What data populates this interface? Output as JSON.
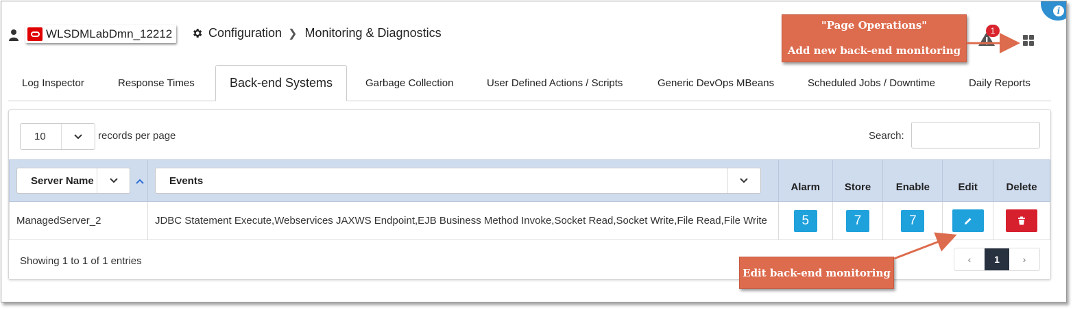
{
  "header": {
    "domain_name": "WLSDMLabDmn_12212",
    "breadcrumb": [
      "Configuration",
      "Monitoring & Diagnostics"
    ],
    "alert_count": "1"
  },
  "callouts": {
    "page_ops_title": "\"Page Operations\"",
    "page_ops_text": "Add new back-end monitoring",
    "edit_text": "Edit back-end monitoring"
  },
  "tabs": [
    {
      "label": "Log Inspector"
    },
    {
      "label": "Response Times"
    },
    {
      "label": "Back-end Systems",
      "active": true
    },
    {
      "label": "Garbage Collection"
    },
    {
      "label": "User Defined Actions / Scripts"
    },
    {
      "label": "Generic DevOps MBeans"
    },
    {
      "label": "Scheduled Jobs / Downtime"
    },
    {
      "label": "Daily Reports"
    }
  ],
  "controls": {
    "page_length": "10",
    "records_per_page": "records per page",
    "search_label": "Search:",
    "search_value": ""
  },
  "table": {
    "columns": [
      "Server Name",
      "Events",
      "Alarm",
      "Store",
      "Enable",
      "Edit",
      "Delete"
    ],
    "rows": [
      {
        "server": "ManagedServer_2",
        "events": "JDBC Statement Execute,Webservices JAXWS Endpoint,EJB Business Method Invoke,Socket Read,Socket Write,File Read,File Write",
        "alarm": "5",
        "store": "7",
        "enable": "7"
      }
    ]
  },
  "footer": {
    "info": "Showing 1 to 1 of 1 entries",
    "prev": "‹",
    "current_page": "1",
    "next": "›"
  },
  "colors": {
    "accent_blue": "#1fa1dc",
    "delete_red": "#d7202e",
    "callout_orange": "#dd6b4d",
    "header_row": "#cfdcee"
  }
}
